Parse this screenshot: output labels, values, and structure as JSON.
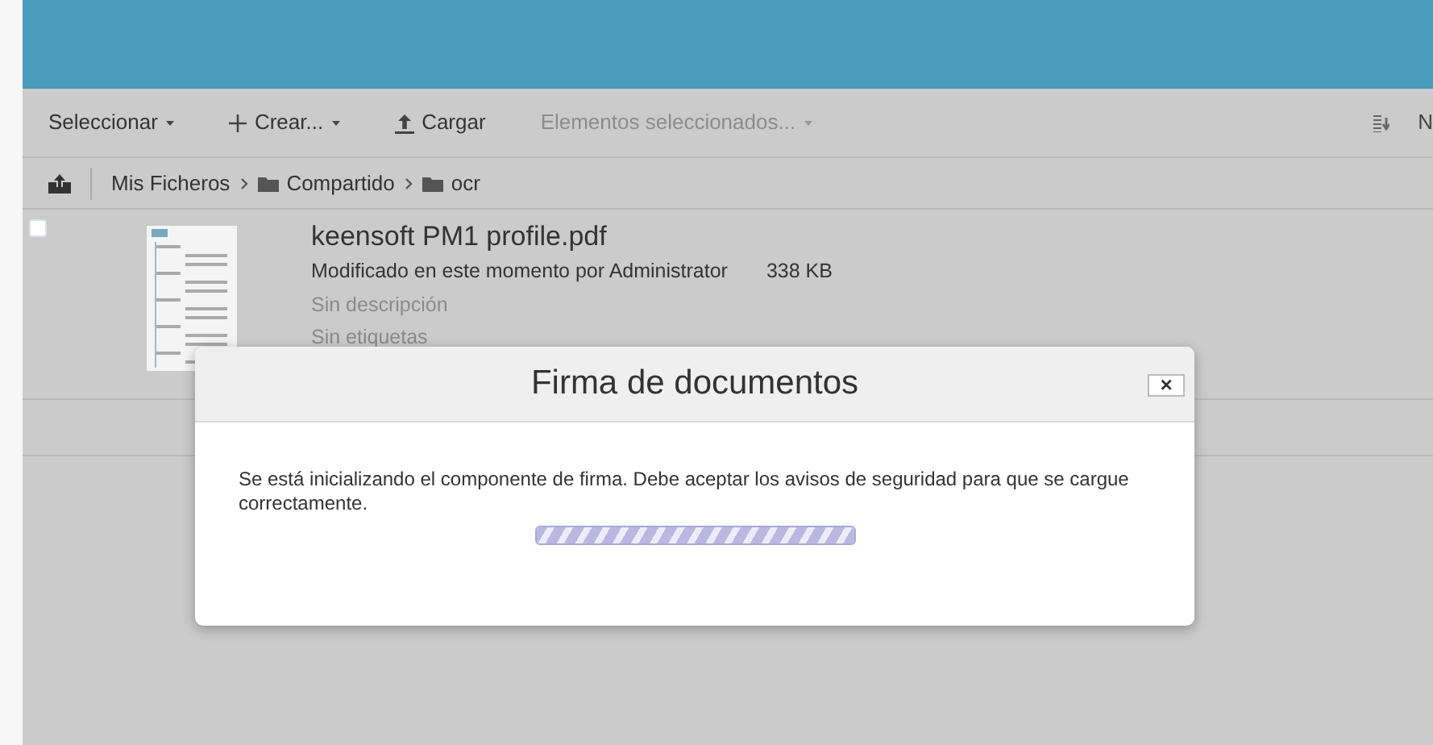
{
  "toolbar": {
    "items": [
      {
        "label": "Seleccionar",
        "kind": "plain",
        "caret": true,
        "disabled": false
      },
      {
        "label": "Crear...",
        "kind": "create",
        "caret": true,
        "disabled": false
      },
      {
        "label": "Cargar",
        "kind": "upload",
        "caret": false,
        "disabled": false
      },
      {
        "label": "Elementos seleccionados...",
        "kind": "plain",
        "caret": true,
        "disabled": true
      }
    ],
    "right_label": "N"
  },
  "breadcrumb": [
    {
      "label": "Mis Ficheros",
      "folder": false
    },
    {
      "label": "Compartido",
      "folder": true
    },
    {
      "label": "ocr",
      "folder": true
    }
  ],
  "file": {
    "checked": false,
    "name": "keensoft PM1 profile.pdf",
    "modified": "Modificado en este momento por Administrator",
    "size": "338 KB",
    "description": "Sin descripción",
    "tags": "Sin etiquetas"
  },
  "dialog": {
    "title": "Firma de documentos",
    "close": "×",
    "message": "Se está inicializando el componente de firma. Debe aceptar los avisos de seguridad para que se cargue correctamente.",
    "progress": {
      "level": 1
    }
  }
}
